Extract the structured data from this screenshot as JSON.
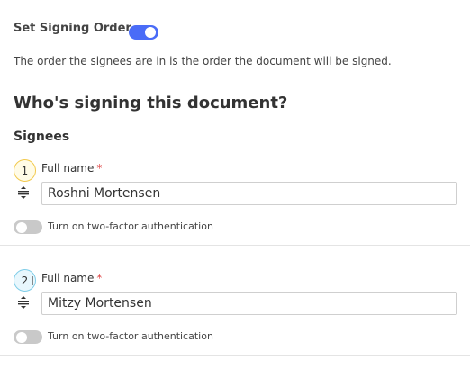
{
  "signing_order": {
    "label": "Set Signing Order",
    "enabled": true,
    "description": "The order the signees are in is the order the document will be signed."
  },
  "heading": "Who's signing this document?",
  "signees_label": "Signees",
  "signees": [
    {
      "number": "1",
      "field_label": "Full name",
      "required_mark": "*",
      "name": "Roshni Mortensen",
      "two_factor_label": "Turn on two-factor authentication",
      "two_factor_enabled": false
    },
    {
      "number": "2",
      "field_label": "Full name",
      "required_mark": "*",
      "name": "Mitzy Mortensen",
      "two_factor_label": "Turn on two-factor authentication",
      "two_factor_enabled": false
    }
  ],
  "colors": {
    "toggle_on": "#4a6cf7",
    "toggle_off": "#c9c9c9",
    "required": "#e04848",
    "badge_1_border": "#f2c94c",
    "badge_2_border": "#7fcde8"
  },
  "icons": {
    "drag": "drag-handle-icon",
    "cursor": "text-cursor-icon"
  }
}
